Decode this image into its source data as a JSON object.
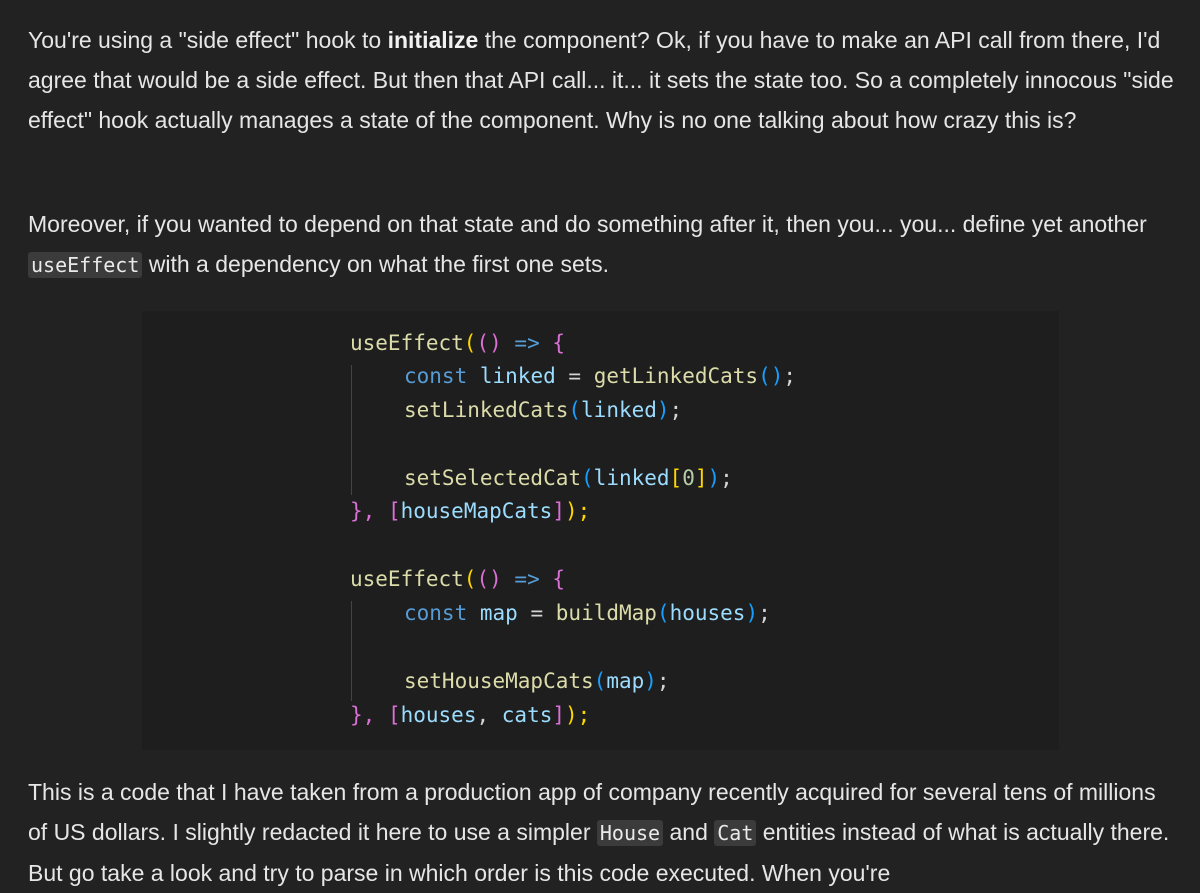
{
  "paragraphs": {
    "p1": {
      "a": "You're using a \"side effect\" hook to ",
      "b": "initialize",
      "c": " the component? Ok, if you have to make an API call from there, I'd agree that would be a side effect. But then that API call... it... it sets the state too. So a completely innocous \"side effect\" hook actually manages a state of the component. Why is no one talking about how crazy this is?"
    },
    "p2": {
      "a": "Moreover, if you wanted to depend on that state and do something after it, then you... you... define yet another ",
      "code": "useEffect",
      "b": " with a dependency on what the first one sets."
    },
    "p3": {
      "a": "This is a code that I have taken from a production app of company recently acquired for several tens of millions of US dollars. I slightly redacted it here to use a simpler ",
      "code1": "House",
      "b": " and ",
      "code2": "Cat",
      "c": " entities instead of what is actually there. But go take a look and try to parse in which order is this code executed. When you're"
    }
  },
  "code": {
    "useEffect": "useEffect",
    "lp": "(",
    "rp": ")",
    "arrow": "=>",
    "lbrace": "{",
    "close_brace": "},",
    "lbr": "[",
    "rbr": "]",
    "rp_semi": ");",
    "semi": ";",
    "const": "const",
    "eq": "=",
    "comma": ",",
    "linked": "linked",
    "getLinkedCats": "getLinkedCats",
    "setLinkedCats": "setLinkedCats",
    "setSelectedCat": "setSelectedCat",
    "zero": "0",
    "houseMapCats": "houseMapCats",
    "map": "map",
    "buildMap": "buildMap",
    "houses": "houses",
    "setHouseMapCats": "setHouseMapCats",
    "cats": "cats"
  }
}
